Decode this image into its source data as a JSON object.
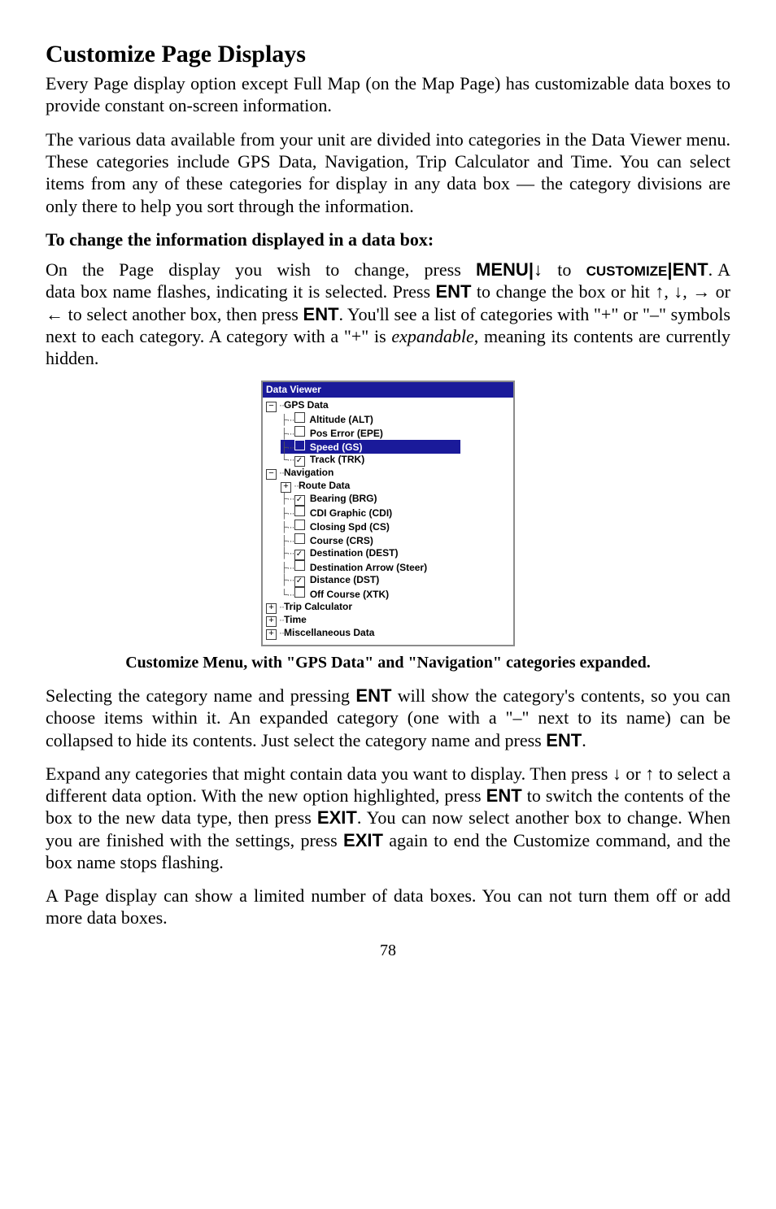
{
  "title": "Customize Page Displays",
  "para1": "Every Page display option except Full Map (on the Map Page) has customizable data boxes to provide constant on-screen information.",
  "para2": "The various data available from your unit are divided into categories in the Data Viewer menu. These categories include GPS Data, Navigation, Trip Calculator and Time. You can select items from any of these categories for display in any data box — the category divisions are only there to help you sort through the information.",
  "subhead": "To change the information displayed in a data box:",
  "step": {
    "line1a": "On the Page display you wish to change, press ",
    "menu": "MENU",
    "pipe": "|",
    "downarrow": "↓",
    "line1b": " to ",
    "customize": "CUSTOMIZE",
    "ent": "ENT",
    "line2": ". A data box name flashes, indicating it is selected. Press ",
    "line3": " to change the box or hit ↑, ↓, → or ← to select another box, then press ",
    "line4": ". You'll see a list of categories with \"+\" or \"–\" symbols next to each category. A category with a \"+\" is ",
    "expandable": "expandable",
    "line5": ", meaning its contents are currently hidden."
  },
  "fig": {
    "title": "Data Viewer",
    "gps": "GPS Data",
    "alt": "Altitude (ALT)",
    "epe": "Pos Error (EPE)",
    "gs": "Speed (GS)",
    "trk": "Track (TRK)",
    "nav": "Navigation",
    "route": "Route Data",
    "brg": "Bearing (BRG)",
    "cdi": "CDI Graphic (CDI)",
    "cs": "Closing Spd (CS)",
    "crs": "Course (CRS)",
    "dest": "Destination (DEST)",
    "steer": "Destination Arrow (Steer)",
    "dst": "Distance (DST)",
    "xtk": "Off Course (XTK)",
    "trip": "Trip Calculator",
    "time": "Time",
    "misc": "Miscellaneous Data"
  },
  "caption": "Customize Menu, with \"GPS Data\" and \"Navigation\" categories expanded.",
  "para3a": "Selecting the category name and pressing ",
  "para3b": " will show the category's contents, so you can choose items within it. An expanded category (one with a \"–\" next to its name) can be collapsed to hide its contents. Just select the category name and press ",
  "para3c": ".",
  "para4a": "Expand any categories that might contain data you want to display. Then press ↓ or ↑ to select a different data option. With the new option highlighted, press ",
  "para4b": " to switch the contents of the box to the new data type, then press ",
  "exit": "EXIT",
  "para4c": ". You can now select another box to change. When you are finished with the settings, press ",
  "para4d": " again to end the Customize command, and the box name stops flashing.",
  "para5": "A Page display can show a limited number of data boxes. You can not turn them off or add more data boxes.",
  "pagenum": "78"
}
